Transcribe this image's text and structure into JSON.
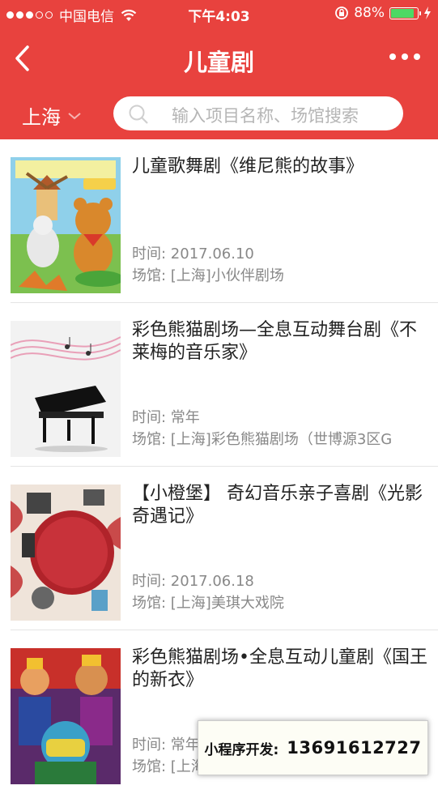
{
  "status_bar": {
    "carrier": "中国电信",
    "time": "下午4:03",
    "battery": "88%",
    "battery_level": 0.88
  },
  "nav": {
    "title": "儿童剧"
  },
  "filter": {
    "city": "上海",
    "search_placeholder": "输入项目名称、场馆搜索"
  },
  "shows": [
    {
      "title": "儿童歌舞剧《维尼熊的故事》",
      "time": "时间:  2017.06.10",
      "venue": "场馆:  [上海]小伙伴剧场",
      "poster": "winnie-bear-poster"
    },
    {
      "title": "彩色熊猫剧场—全息互动舞台剧《不莱梅的音乐家》",
      "time": "时间:  常年",
      "venue": "场馆:  [上海]彩色熊猫剧场（世博源3区G",
      "poster": "piano-poster"
    },
    {
      "title": "【小橙堡】 奇幻音乐亲子喜剧《光影奇遇记》",
      "time": "时间:  2017.06.18",
      "venue": "场馆:  [上海]美琪大戏院",
      "poster": "shadow-adventure-poster"
    },
    {
      "title": "彩色熊猫剧场•全息互动儿童剧《国王的新衣》",
      "time": "时间:  常年",
      "venue": "场馆:  [上海]彩色熊猫剧场",
      "poster": "king-new-clothes-poster"
    }
  ],
  "overlay": {
    "label": "小程序开发:",
    "phone": "13691612727"
  }
}
